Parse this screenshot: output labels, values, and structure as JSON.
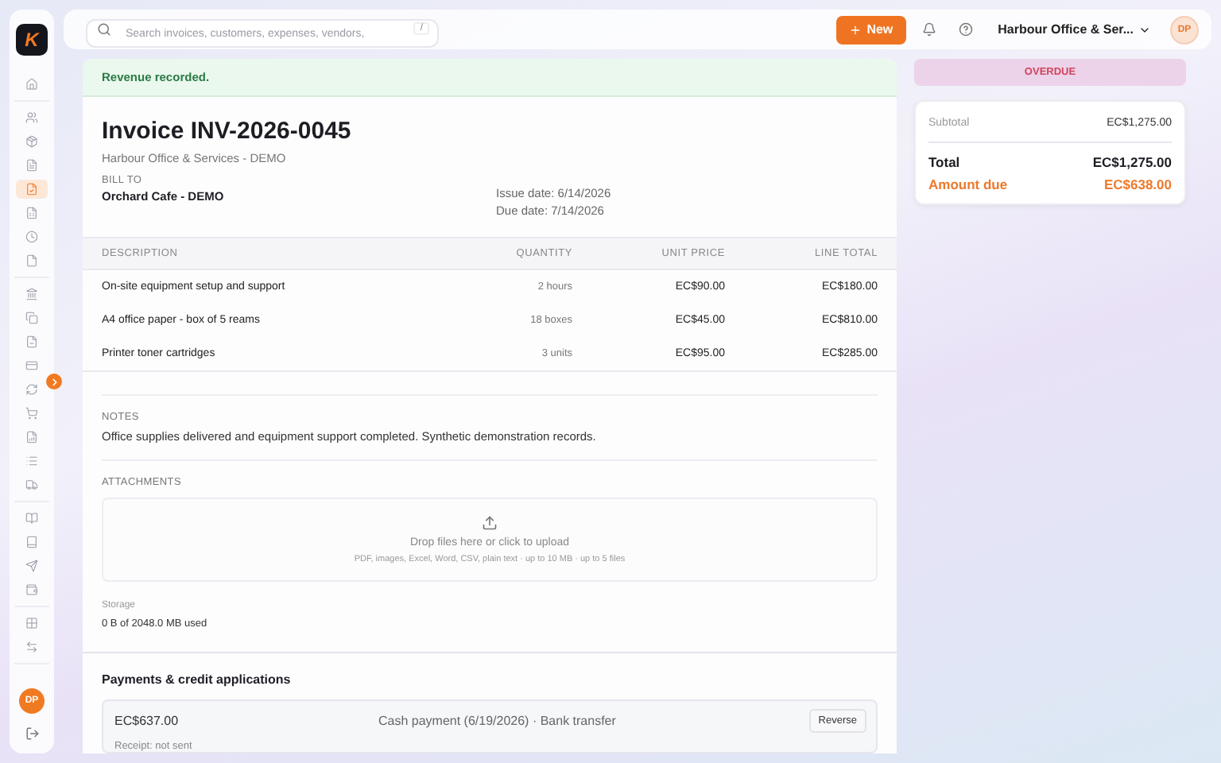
{
  "sidebar": {
    "logo": "K",
    "groups": [
      {
        "items": [
          {
            "selected": false
          }
        ]
      },
      {
        "items": [
          {
            "selected": false
          },
          {
            "selected": false
          },
          {
            "selected": false
          },
          {
            "selected": true
          },
          {
            "selected": false
          },
          {
            "selected": false
          },
          {
            "selected": false
          }
        ]
      },
      {
        "items": [
          {
            "selected": false
          },
          {
            "selected": false
          },
          {
            "selected": false
          },
          {
            "selected": false
          },
          {
            "selected": false
          },
          {
            "selected": false
          },
          {
            "selected": false
          },
          {
            "selected": false
          },
          {
            "selected": false
          }
        ]
      },
      {
        "items": [
          {
            "selected": false
          },
          {
            "selected": false
          },
          {
            "selected": false
          },
          {
            "selected": false
          }
        ]
      },
      {
        "items": [
          {
            "selected": false
          },
          {
            "selected": false
          }
        ]
      }
    ],
    "avatar": "DP"
  },
  "topbar": {
    "search": {
      "placeholder": "Search invoices, customers, expenses, vendors,",
      "shortcut": "/"
    },
    "new_button": "New",
    "org": "Harbour Office & Ser...",
    "avatar": "DP"
  },
  "flash": "Revenue recorded.",
  "invoice": {
    "title": "Invoice INV-2026-0045",
    "company": "Harbour Office & Services - DEMO",
    "bill_to_label": "BILL TO",
    "bill_to": "Orchard Cafe - DEMO",
    "issue_date": "Issue date: 6/14/2026",
    "due_date": "Due date: 7/14/2026"
  },
  "table": {
    "columns": [
      "DESCRIPTION",
      "QUANTITY",
      "UNIT PRICE",
      "LINE TOTAL"
    ],
    "rows": [
      [
        "On-site equipment setup and support",
        "2 hours",
        "EC$90.00",
        "EC$180.00"
      ],
      [
        "A4 office paper - box of 5 reams",
        "18 boxes",
        "EC$45.00",
        "EC$810.00"
      ],
      [
        "Printer toner cartridges",
        "3 units",
        "EC$95.00",
        "EC$285.00"
      ]
    ]
  },
  "notes": {
    "label": "NOTES",
    "text": "Office supplies delivered and equipment support completed. Synthetic demonstration records."
  },
  "attachments": {
    "label": "ATTACHMENTS",
    "drop_text": "Drop files here or click to upload",
    "hint": "PDF, images, Excel, Word, CSV, plain text · up to 10 MB · up to 5 files",
    "storage_label": "Storage",
    "storage_used": "0 B of 2048.0 MB used"
  },
  "payments": {
    "title": "Payments & credit applications",
    "items": [
      {
        "amount": "EC$637.00",
        "description": "Cash payment (6/19/2026) · Bank transfer",
        "button": "Reverse",
        "receipt": "Receipt: not sent"
      }
    ]
  },
  "summary": {
    "status": "OVERDUE",
    "subtotal_label": "Subtotal",
    "subtotal": "EC$1,275.00",
    "total_label": "Total",
    "total": "EC$1,275.00",
    "due_label": "Amount due",
    "due": "EC$638.00"
  }
}
